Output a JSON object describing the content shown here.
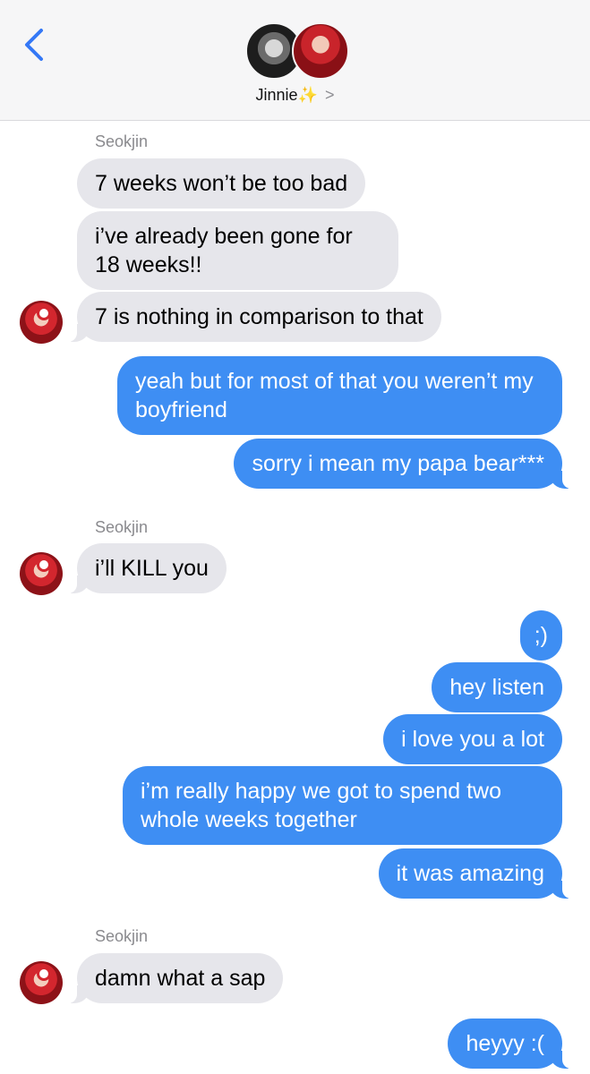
{
  "header": {
    "contact_name": "Jinnie",
    "sparkle": "✨",
    "chevron": ">",
    "back_icon": "chevron-left-icon",
    "accent": "#3478f6"
  },
  "colors": {
    "incoming_bubble": "#e6e6eb",
    "outgoing_bubble": "#3e8ef3"
  },
  "thread": {
    "sender_name": "Seokjin",
    "messages": [
      "7 weeks won’t be too bad",
      "i’ve already been gone for 18 weeks!!",
      "7 is nothing in comparison to that",
      "yeah but for most of that you weren’t my boyfriend",
      "sorry i mean my papa bear***",
      "i’ll KILL you",
      ";)",
      "hey listen",
      "i love you a lot",
      "i’m really happy we got to spend two whole weeks together",
      "it was amazing",
      "damn what a sap",
      "heyyy :("
    ]
  }
}
